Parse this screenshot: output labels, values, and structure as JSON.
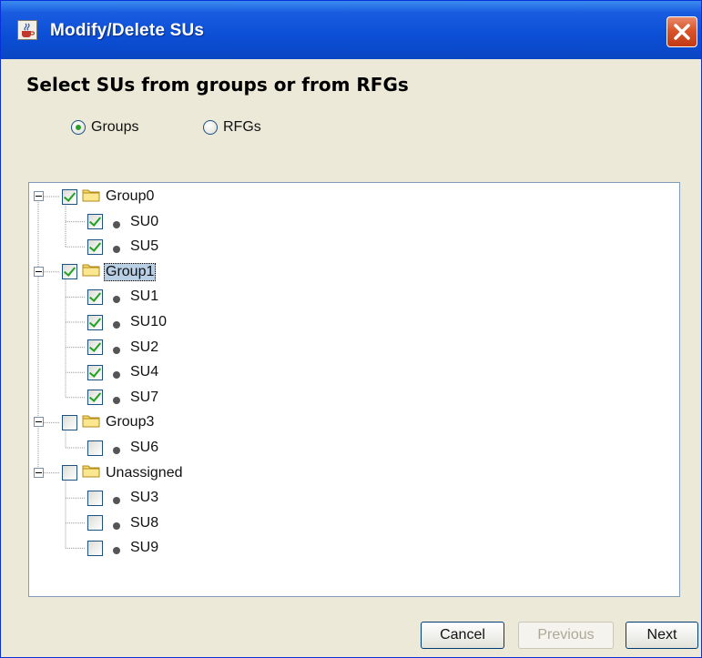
{
  "window": {
    "title": "Modify/Delete SUs"
  },
  "heading": "Select SUs from groups or from RFGs",
  "radio_options": [
    {
      "label": "Groups",
      "selected": true
    },
    {
      "label": "RFGs",
      "selected": false
    }
  ],
  "tree": {
    "groups": [
      {
        "label": "Group0",
        "checked": true,
        "selected": false,
        "children": [
          {
            "label": "SU0",
            "checked": true
          },
          {
            "label": "SU5",
            "checked": true
          }
        ]
      },
      {
        "label": "Group1",
        "checked": true,
        "selected": true,
        "children": [
          {
            "label": "SU1",
            "checked": true
          },
          {
            "label": "SU10",
            "checked": true
          },
          {
            "label": "SU2",
            "checked": true
          },
          {
            "label": "SU4",
            "checked": true
          },
          {
            "label": "SU7",
            "checked": true
          }
        ]
      },
      {
        "label": "Group3",
        "checked": false,
        "selected": false,
        "children": [
          {
            "label": "SU6",
            "checked": false
          }
        ]
      },
      {
        "label": "Unassigned",
        "checked": false,
        "selected": false,
        "children": [
          {
            "label": "SU3",
            "checked": false
          },
          {
            "label": "SU8",
            "checked": false
          },
          {
            "label": "SU9",
            "checked": false
          }
        ]
      }
    ]
  },
  "buttons": {
    "cancel": "Cancel",
    "previous": "Previous",
    "next": "Next"
  },
  "colors": {
    "titlebar": "#0b4fd6",
    "window_bg": "#ece9d8",
    "selection": "#b8cfe5",
    "check": "#21a121"
  },
  "icons": {
    "app": "java-cup-icon",
    "close": "close-icon",
    "group": "folder-icon",
    "su": "dot-icon"
  }
}
